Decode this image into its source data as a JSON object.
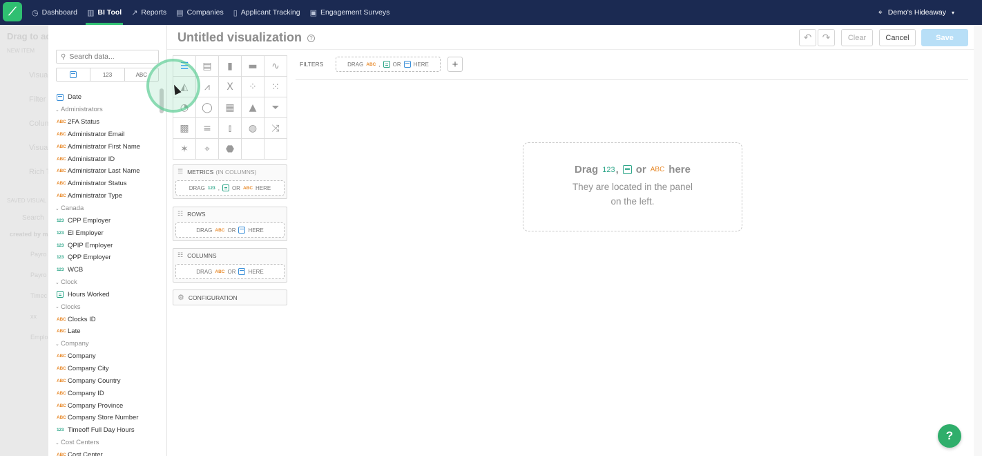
{
  "nav": {
    "items": [
      {
        "icon": "dashboard-icon",
        "glyph": "◷",
        "label": "Dashboard",
        "active": false
      },
      {
        "icon": "bi-tool-icon",
        "glyph": "▥",
        "label": "BI Tool",
        "active": true
      },
      {
        "icon": "reports-icon",
        "glyph": "↗",
        "label": "Reports",
        "active": false
      },
      {
        "icon": "companies-icon",
        "glyph": "▤",
        "label": "Companies",
        "active": false
      },
      {
        "icon": "applicant-icon",
        "glyph": "▯",
        "label": "Applicant Tracking",
        "active": false
      },
      {
        "icon": "surveys-icon",
        "glyph": "▣",
        "label": "Engagement Surveys",
        "active": false
      }
    ],
    "location": "Demo's Hideaway"
  },
  "background_panel": {
    "title": "Drag to add",
    "new_item": "NEW ITEM",
    "items": [
      "Visual",
      "Filter",
      "Colum",
      "Visual",
      "Rich Te"
    ],
    "saved": "SAVED VISUAL",
    "search": "Search",
    "created_by": "created by m",
    "saved_items": [
      "Payro",
      "Payro",
      "Timec",
      "xx",
      "Emplo"
    ]
  },
  "field_panel": {
    "search_placeholder": "Search data...",
    "type_tabs": [
      "",
      "123",
      "ABC"
    ],
    "date_label": "Date",
    "groups": [
      {
        "name": "Administrators",
        "fields": [
          {
            "t": "ABC",
            "n": "2FA Status"
          },
          {
            "t": "ABC",
            "n": "Administrator Email"
          },
          {
            "t": "ABC",
            "n": "Administrator First Name"
          },
          {
            "t": "ABC",
            "n": "Administrator ID"
          },
          {
            "t": "ABC",
            "n": "Administrator Last Name"
          },
          {
            "t": "ABC",
            "n": "Administrator Status"
          },
          {
            "t": "ABC",
            "n": "Administrator Type"
          }
        ]
      },
      {
        "name": "Canada",
        "fields": [
          {
            "t": "123",
            "n": "CPP Employer"
          },
          {
            "t": "123",
            "n": "EI Employer"
          },
          {
            "t": "123",
            "n": "QPIP Employer"
          },
          {
            "t": "123",
            "n": "QPP Employer"
          },
          {
            "t": "123",
            "n": "WCB"
          }
        ]
      },
      {
        "name": "Clock",
        "fields": [
          {
            "t": "FACT",
            "n": "Hours Worked"
          }
        ]
      },
      {
        "name": "Clocks",
        "fields": [
          {
            "t": "ABC",
            "n": "Clocks ID"
          },
          {
            "t": "ABC",
            "n": "Late"
          }
        ]
      },
      {
        "name": "Company",
        "fields": [
          {
            "t": "ABC",
            "n": "Company"
          },
          {
            "t": "ABC",
            "n": "Company City"
          },
          {
            "t": "ABC",
            "n": "Company Country"
          },
          {
            "t": "ABC",
            "n": "Company ID"
          },
          {
            "t": "ABC",
            "n": "Company Province"
          },
          {
            "t": "ABC",
            "n": "Company Store Number"
          },
          {
            "t": "123",
            "n": "Timeoff Full Day Hours"
          }
        ]
      },
      {
        "name": "Cost Centers",
        "fields": [
          {
            "t": "ABC",
            "n": "Cost Center"
          }
        ]
      }
    ]
  },
  "header": {
    "title": "Untitled visualization",
    "help": "?",
    "undo": "↶",
    "redo": "↷",
    "clear": "Clear",
    "cancel": "Cancel",
    "save": "Save"
  },
  "vis_types": [
    {
      "name": "table-icon",
      "g": "☰",
      "sel": true
    },
    {
      "name": "pivot-table-icon",
      "g": "▤"
    },
    {
      "name": "column-chart-icon",
      "g": "▮"
    },
    {
      "name": "bar-chart-icon",
      "g": "▬"
    },
    {
      "name": "line-chart-icon",
      "g": "∿"
    },
    {
      "name": "area-chart-icon",
      "g": "◭"
    },
    {
      "name": "combo-chart-icon",
      "g": "⩘"
    },
    {
      "name": "headline-icon",
      "g": "X"
    },
    {
      "name": "scatter-plot-icon",
      "g": "⁘"
    },
    {
      "name": "bubble-chart-icon",
      "g": "⁙"
    },
    {
      "name": "pie-chart-icon",
      "g": "◔"
    },
    {
      "name": "donut-chart-icon",
      "g": "◯"
    },
    {
      "name": "treemap-icon",
      "g": "▦"
    },
    {
      "name": "pyramid-icon",
      "g": "▲"
    },
    {
      "name": "funnel-icon",
      "g": "⏷"
    },
    {
      "name": "heatmap-icon",
      "g": "▩"
    },
    {
      "name": "bullet-chart-icon",
      "g": "≡"
    },
    {
      "name": "waterfall-icon",
      "g": "⫾"
    },
    {
      "name": "geo-chart-icon",
      "g": "◍"
    },
    {
      "name": "sankey-icon",
      "g": "⤨"
    },
    {
      "name": "radar-icon",
      "g": "✶"
    },
    {
      "name": "pushpin-map-icon",
      "g": "⌖"
    },
    {
      "name": "region-map-icon",
      "g": "⬣"
    },
    {
      "name": "empty-slot",
      "g": ""
    },
    {
      "name": "empty-slot",
      "g": ""
    }
  ],
  "buckets": {
    "metrics": {
      "title": "METRICS",
      "sub": "(IN COLUMNS)"
    },
    "rows": {
      "title": "ROWS"
    },
    "columns": {
      "title": "COLUMNS"
    },
    "configuration": {
      "title": "CONFIGURATION"
    }
  },
  "drop_text": {
    "drag": "DRAG",
    "or": "OR",
    "here": "HERE",
    "comma": ",",
    "abc": "ABC",
    "num": "123"
  },
  "filters": {
    "label": "FILTERS",
    "plus": "+"
  },
  "canvas": {
    "drag": "Drag",
    "num": "123",
    "comma": ",",
    "or": "or",
    "abc": "ABC",
    "here": "here",
    "line2": "They are located in the panel",
    "line3": "on the left."
  },
  "chat_icon": "?"
}
